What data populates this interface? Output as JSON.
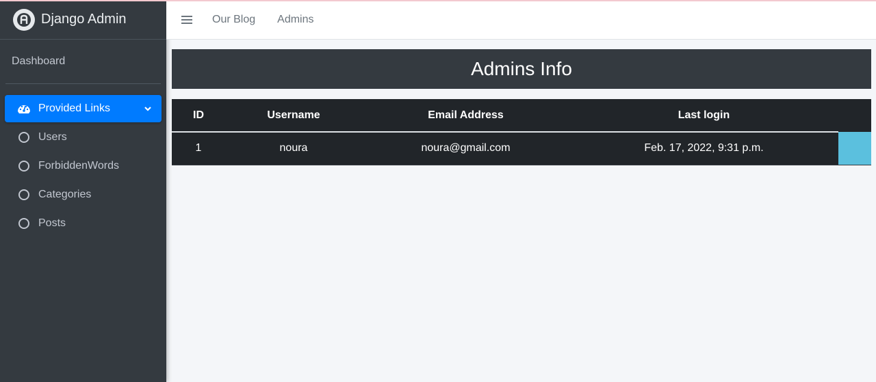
{
  "brand": {
    "title": "Django Admin"
  },
  "sidebar": {
    "dashboard": "Dashboard",
    "group_label": "Provided Links",
    "items": [
      {
        "label": "Users"
      },
      {
        "label": "ForbiddenWords"
      },
      {
        "label": "Categories"
      },
      {
        "label": "Posts"
      }
    ]
  },
  "navbar": {
    "links": [
      {
        "label": "Our Blog"
      },
      {
        "label": "Admins"
      }
    ]
  },
  "main": {
    "title": "Admins Info",
    "table": {
      "headers": [
        "ID",
        "Username",
        "Email Address",
        "Last login"
      ],
      "rows": [
        [
          "1",
          "noura",
          "noura@gmail.com",
          "Feb. 17, 2022, 9:31 p.m."
        ]
      ]
    }
  },
  "colors": {
    "sidebar_bg": "#343a40",
    "active_item": "#007bff",
    "table_bg": "#212529",
    "action_cell": "#5bc0de"
  }
}
